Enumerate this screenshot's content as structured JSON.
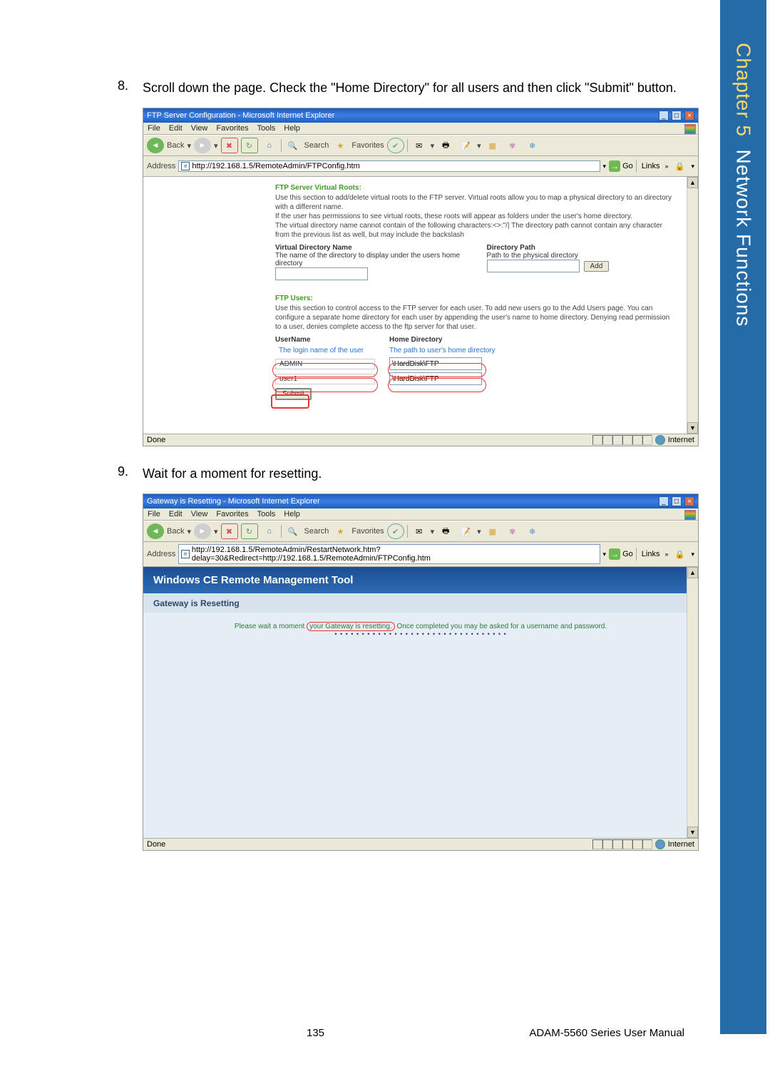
{
  "margin": {
    "chapter": "Chapter 5",
    "title": "Network Functions"
  },
  "step8": {
    "num": "8.",
    "text": "Scroll down the page. Check the \"Home Directory\" for all users and then click \"Submit\" button."
  },
  "step9": {
    "num": "9.",
    "text": "Wait for a moment for resetting."
  },
  "menu": {
    "file": "File",
    "edit": "Edit",
    "view": "View",
    "fav": "Favorites",
    "tools": "Tools",
    "help": "Help"
  },
  "toolbar": {
    "back": "Back",
    "search": "Search",
    "favorites": "Favorites"
  },
  "addr": {
    "label": "Address",
    "go": "Go",
    "links": "Links"
  },
  "status": {
    "done": "Done",
    "zone": "Internet"
  },
  "s1": {
    "title": "FTP Server Configuration - Microsoft Internet Explorer",
    "url": "http://192.168.1.5/RemoteAdmin/FTPConfig.htm",
    "roots_title": "FTP Server Virtual Roots:",
    "roots_desc1": "Use this section to add/delete virtual roots to the FTP server. Virtual roots allow you to map a physical directory to an directory with a different name.",
    "roots_desc2": "If the user has permissions to see virtual roots, these roots will appear as folders under the user's home directory.",
    "roots_desc3": "The virtual directory name cannot contain of the following characters:<>:\"/| The directory path cannot contain any character from the previous list as well, but may include the backslash",
    "vdn": "Virtual Directory Name",
    "vdn_sub": "The name of the directory to display under the users home directory",
    "dp": "Directory Path",
    "dp_sub": "Path to the physical directory",
    "add": "Add",
    "users_title": "FTP Users:",
    "users_desc": "Use this section to control access to the FTP server for each user. To add new users go to the Add Users page. You can configure a separate home directory for each user by appending the user's name to home directory. Denying read permission to a user, denies complete access to the ftp server for that user.",
    "un": "UserName",
    "un_sub": "The login name of the user",
    "hd": "Home Directory",
    "hd_sub": "The path to user's home directory",
    "u1": "ADMIN",
    "u1d": "\\HardDisk\\FTP",
    "u2": "user1",
    "u2d": "\\HardDisk\\FTP",
    "submit": "Submit"
  },
  "s2": {
    "title": "Gateway is Resetting - Microsoft Internet Explorer",
    "url": "http://192.168.1.5/RemoteAdmin/RestartNetwork.htm?delay=30&Redirect=http://192.168.1.5/RemoteAdmin/FTPConfig.htm",
    "rm_title": "Windows CE Remote Management Tool",
    "rm_sub": "Gateway is Resetting",
    "rm_msg_a": "Please wait a moment ",
    "rm_msg_b": "your Gateway is resetting.",
    "rm_msg_c": " Once completed you may be asked for a username and password.",
    "rm_dots": "• • • • • • • • • • • • • • • • • • • • • • • • • • • • • • • •"
  },
  "footer": {
    "page": "135",
    "manual": "ADAM-5560 Series User Manual"
  }
}
